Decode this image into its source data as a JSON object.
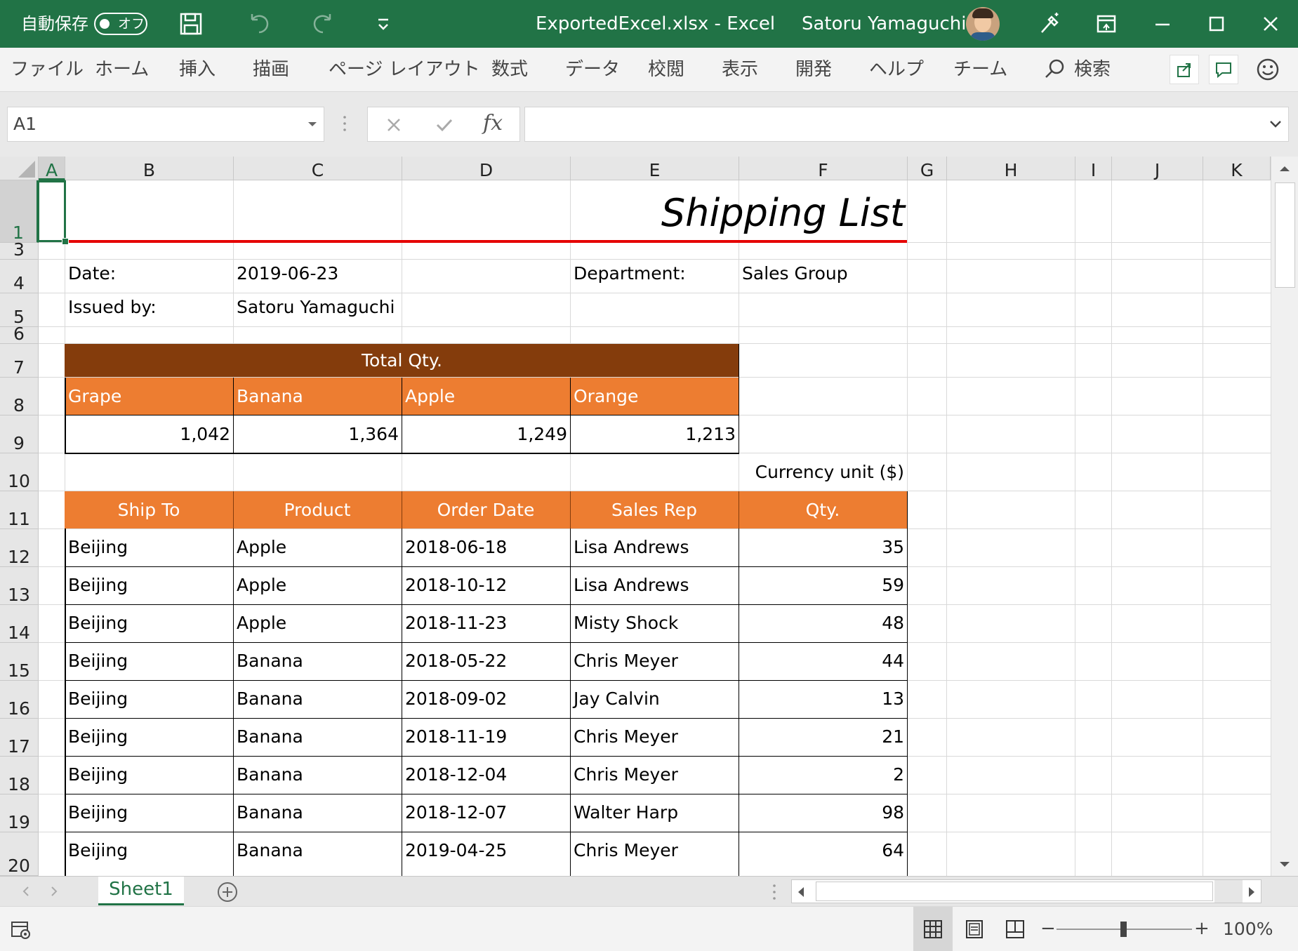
{
  "titlebar": {
    "autosave_label": "自動保存",
    "autosave_state": "オフ",
    "file_title": "ExportedExcel.xlsx - Excel",
    "user_name": "Satoru Yamaguchi",
    "bg_color": "#217346"
  },
  "menu": {
    "items": [
      "ファイル",
      "ホーム",
      "挿入",
      "描画",
      "ページ レイアウト",
      "数式",
      "データ",
      "校閲",
      "表示",
      "開発",
      "ヘルプ",
      "チーム"
    ],
    "search_label": "検索"
  },
  "formula_bar": {
    "name_box": "A1",
    "fx_label": "fx",
    "formula": ""
  },
  "columns": [
    "A",
    "B",
    "C",
    "D",
    "E",
    "F",
    "G",
    "H",
    "I",
    "J",
    "K"
  ],
  "rows": [
    "1",
    "3",
    "4",
    "5",
    "6",
    "7",
    "8",
    "9",
    "10",
    "11",
    "12",
    "13",
    "14",
    "15",
    "16",
    "17",
    "18",
    "19",
    "20"
  ],
  "sheet": {
    "title": "Shipping List",
    "date_label": "Date:",
    "date_value": "2019-06-23",
    "issued_label": "Issued by:",
    "issued_value": "Satoru Yamaguchi",
    "department_label": "Department:",
    "department_value": "Sales Group",
    "total_header": "Total Qty.",
    "totals": [
      {
        "name": "Grape",
        "qty": "1,042"
      },
      {
        "name": "Banana",
        "qty": "1,364"
      },
      {
        "name": "Apple",
        "qty": "1,249"
      },
      {
        "name": "Orange",
        "qty": "1,213"
      }
    ],
    "currency_note": "Currency unit ($)",
    "table_headers": [
      "Ship To",
      "Product",
      "Order Date",
      "Sales Rep",
      "Qty."
    ],
    "table_rows": [
      [
        "Beijing",
        "Apple",
        "2018-06-18",
        "Lisa Andrews",
        "35"
      ],
      [
        "Beijing",
        "Apple",
        "2018-10-12",
        "Lisa Andrews",
        "59"
      ],
      [
        "Beijing",
        "Apple",
        "2018-11-23",
        "Misty Shock",
        "48"
      ],
      [
        "Beijing",
        "Banana",
        "2018-05-22",
        "Chris Meyer",
        "44"
      ],
      [
        "Beijing",
        "Banana",
        "2018-09-02",
        "Jay Calvin",
        "13"
      ],
      [
        "Beijing",
        "Banana",
        "2018-11-19",
        "Chris Meyer",
        "21"
      ],
      [
        "Beijing",
        "Banana",
        "2018-12-04",
        "Chris Meyer",
        "2"
      ],
      [
        "Beijing",
        "Banana",
        "2018-12-07",
        "Walter Harp",
        "98"
      ],
      [
        "Beijing",
        "Banana",
        "2019-04-25",
        "Chris Meyer",
        "64"
      ]
    ],
    "colors": {
      "header_dark": "#843c0c",
      "header_orange": "#ed7d31",
      "title_line": "#e50000"
    }
  },
  "tabs": {
    "sheet_name": "Sheet1"
  },
  "status": {
    "zoom": "100%"
  }
}
